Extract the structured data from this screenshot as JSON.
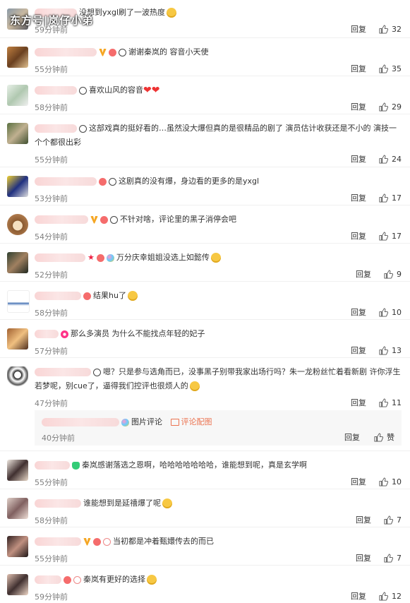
{
  "watermark": "东方号|岚仔小弟",
  "reply_label": "回复",
  "comments": [
    {
      "text": "没想到yxgl刷了一波热度",
      "time": "59分钟前",
      "likes": "32"
    },
    {
      "text": "谢谢秦岚的 容音小天使",
      "time": "55分钟前",
      "likes": "35"
    },
    {
      "text": "喜欢山风的容音",
      "time": "58分钟前",
      "likes": "29"
    },
    {
      "text": "这部戏真的挺好看的…虽然没大爆但真的是很精品的剧了 演员估计收获还是不小的 演技一个个都很出彩",
      "time": "55分钟前",
      "likes": "24"
    },
    {
      "text": "这剧真的没有爆，身边看的更多的是yxgl",
      "time": "53分钟前",
      "likes": "17"
    },
    {
      "text": "不针对啥，评论里的黑子消停会吧",
      "time": "54分钟前",
      "likes": "17"
    },
    {
      "text": "万分庆幸姐姐没选上如懿传",
      "time": "52分钟前",
      "likes": "9"
    },
    {
      "text": "结果hu了",
      "time": "58分钟前",
      "likes": "10"
    },
    {
      "text": "那么多演员 为什么不能找点年轻的妃子",
      "time": "57分钟前",
      "likes": "13"
    },
    {
      "text": "嗯？只是参与选角而已，没事黑子别带我家出场行吗？朱一龙粉丝忙着看新剧 许你浮生若梦呢，别cue了，逼得我们控评也很烦人的",
      "time": "47分钟前",
      "likes": "11"
    },
    {
      "text": "秦岚感谢落选之恩啊，哈哈哈哈哈哈哈，谁能想到呢，真是玄学啊",
      "time": "55分钟前",
      "likes": "10"
    },
    {
      "text": "谁能想到是延禧爆了呢",
      "time": "58分钟前",
      "likes": "7"
    },
    {
      "text": "当初都是冲着甄嬛传去的而已",
      "time": "55分钟前",
      "likes": "7"
    },
    {
      "text": "秦岚有更好的选择",
      "time": "59分钟前",
      "likes": "12"
    }
  ],
  "sub_reply": {
    "pic_comment": "图片评论",
    "pic_match": "评论配图",
    "time": "40分钟前",
    "reply": "回复",
    "like": "赞"
  },
  "colors": {
    "accent": "#eb7350",
    "meta": "#808080",
    "heart": "#e33333"
  }
}
